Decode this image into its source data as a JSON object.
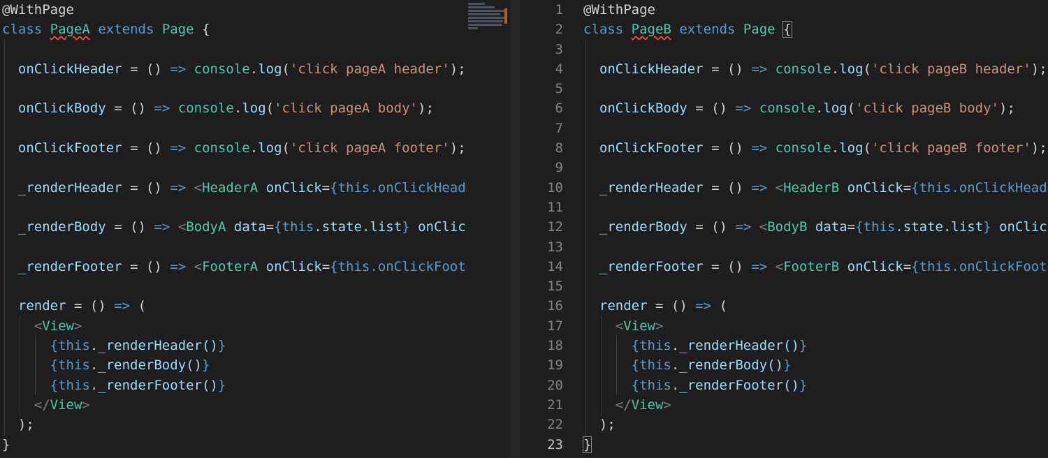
{
  "left_editor": {
    "class_name": "PageA",
    "strings": {
      "header": "'click pageA header'",
      "body": "'click pageA body'",
      "footer": "'click pageA footer'"
    },
    "components": {
      "header": "HeaderA",
      "body": "BodyA",
      "footer": "FooterA"
    },
    "truncated": {
      "header_tail": "{this.onClickHeade",
      "body_tail": "onClick",
      "footer_tail": "{this.onClickFoote"
    }
  },
  "right_editor": {
    "class_name": "PageB",
    "line_numbers": [
      "1",
      "2",
      "3",
      "4",
      "5",
      "6",
      "7",
      "8",
      "9",
      "10",
      "11",
      "12",
      "13",
      "14",
      "15",
      "16",
      "17",
      "18",
      "19",
      "20",
      "21",
      "22",
      "23"
    ],
    "strings": {
      "header": "'click pageB header'",
      "body": "'click pageB body'",
      "footer": "'click pageB footer'"
    },
    "components": {
      "header": "HeaderB",
      "body": "BodyB",
      "footer": "FooterB"
    },
    "truncated": {
      "header_tail": "{this.onClickHeade",
      "body_tail": "onClick",
      "footer_tail": "{this.onClickFoote"
    }
  },
  "shared": {
    "decorator": "@WithPage",
    "kw_class": "class",
    "kw_extends": "extends",
    "base_class": "Page",
    "handlers": [
      "onClickHeader",
      "onClickBody",
      "onClickFooter"
    ],
    "renderers": [
      "_renderHeader",
      "_renderBody",
      "_renderFooter"
    ],
    "view_tag": "View",
    "render_fn": "render",
    "console": "console",
    "log": "log",
    "this_kw": "this",
    "state_expr": ".state.list",
    "data_attr": "data",
    "onclick_attr": "onClick",
    "calls": [
      "._renderHeader()",
      "._renderBody()",
      "._renderFooter()"
    ]
  },
  "colors": {
    "background": "#1e1e1e",
    "keyword": "#569cd6",
    "class_name": "#4ec9b0",
    "string": "#ce9178",
    "identifier": "#9cdcfe",
    "line_number": "#858585"
  }
}
